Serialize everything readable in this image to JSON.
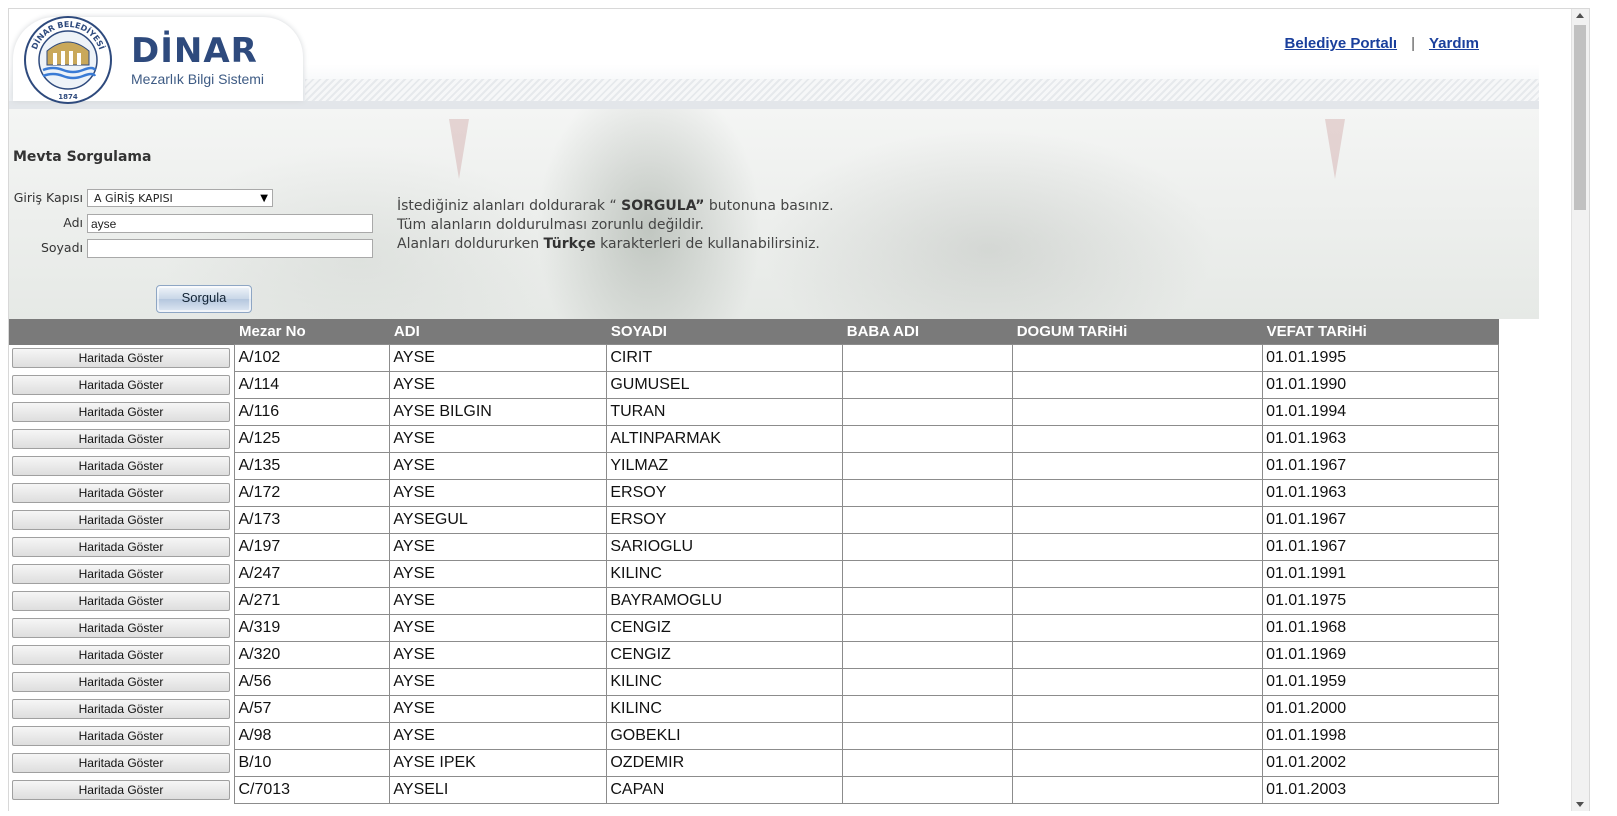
{
  "header": {
    "brand_name": "DİNAR",
    "brand_sub": "Mezarlık Bilgi Sistemi",
    "seal_text": "DİNAR BELEDİYESİ",
    "seal_year": "1874",
    "nav": {
      "portal": "Belediye Portalı",
      "separator": "|",
      "help": "Yardım"
    }
  },
  "search": {
    "title": "Mevta Sorgulama",
    "gate_label": "Giriş Kapısı",
    "gate_value": "A GİRİŞ KAPISI",
    "name_label": "Adı",
    "name_value": "ayse",
    "surname_label": "Soyadı",
    "surname_value": "",
    "button": "Sorgula",
    "instructions": {
      "line1_a": "İstediğiniz alanları doldurarak “ ",
      "line1_b": "SORGULA”",
      "line1_c": " butonuna basınız.",
      "line2": "Tüm alanların doldurulması zorunlu değildir.",
      "line3_a": "Alanları doldururken ",
      "line3_b": "Türkçe",
      "line3_c": " karakterleri de kullanabilirsiniz."
    }
  },
  "table": {
    "headers": [
      "",
      "Mezar No",
      "ADI",
      "SOYADI",
      "BABA ADI",
      "DOGUM TARiHi",
      "VEFAT TARiHi"
    ],
    "button_label": "Haritada Göster",
    "rows": [
      {
        "mezar": "A/102",
        "adi": "AYSE",
        "soyadi": "CIRIT",
        "baba": "",
        "dogum": "",
        "vefat": "01.01.1995"
      },
      {
        "mezar": "A/114",
        "adi": "AYSE",
        "soyadi": "GUMUSEL",
        "baba": "",
        "dogum": "",
        "vefat": "01.01.1990"
      },
      {
        "mezar": "A/116",
        "adi": "AYSE BILGIN",
        "soyadi": "TURAN",
        "baba": "",
        "dogum": "",
        "vefat": "01.01.1994"
      },
      {
        "mezar": "A/125",
        "adi": "AYSE",
        "soyadi": "ALTINPARMAK",
        "baba": "",
        "dogum": "",
        "vefat": "01.01.1963"
      },
      {
        "mezar": "A/135",
        "adi": "AYSE",
        "soyadi": "YILMAZ",
        "baba": "",
        "dogum": "",
        "vefat": "01.01.1967"
      },
      {
        "mezar": "A/172",
        "adi": "AYSE",
        "soyadi": "ERSOY",
        "baba": "",
        "dogum": "",
        "vefat": "01.01.1963"
      },
      {
        "mezar": "A/173",
        "adi": "AYSEGUL",
        "soyadi": "ERSOY",
        "baba": "",
        "dogum": "",
        "vefat": "01.01.1967"
      },
      {
        "mezar": "A/197",
        "adi": "AYSE",
        "soyadi": "SARIOGLU",
        "baba": "",
        "dogum": "",
        "vefat": "01.01.1967"
      },
      {
        "mezar": "A/247",
        "adi": "AYSE",
        "soyadi": "KILINC",
        "baba": "",
        "dogum": "",
        "vefat": "01.01.1991"
      },
      {
        "mezar": "A/271",
        "adi": "AYSE",
        "soyadi": "BAYRAMOGLU",
        "baba": "",
        "dogum": "",
        "vefat": "01.01.1975"
      },
      {
        "mezar": "A/319",
        "adi": "AYSE",
        "soyadi": "CENGIZ",
        "baba": "",
        "dogum": "",
        "vefat": "01.01.1968"
      },
      {
        "mezar": "A/320",
        "adi": "AYSE",
        "soyadi": "CENGIZ",
        "baba": "",
        "dogum": "",
        "vefat": "01.01.1969"
      },
      {
        "mezar": "A/56",
        "adi": "AYSE",
        "soyadi": "KILINC",
        "baba": "",
        "dogum": "",
        "vefat": "01.01.1959"
      },
      {
        "mezar": "A/57",
        "adi": "AYSE",
        "soyadi": "KILINC",
        "baba": "",
        "dogum": "",
        "vefat": "01.01.2000"
      },
      {
        "mezar": "A/98",
        "adi": "AYSE",
        "soyadi": "GOBEKLI",
        "baba": "",
        "dogum": "",
        "vefat": "01.01.1998"
      },
      {
        "mezar": "B/10",
        "adi": "AYSE IPEK",
        "soyadi": "OZDEMIR",
        "baba": "",
        "dogum": "",
        "vefat": "01.01.2002"
      },
      {
        "mezar": "C/7013",
        "adi": "AYSELI",
        "soyadi": "CAPAN",
        "baba": "",
        "dogum": "",
        "vefat": "01.01.2003"
      }
    ]
  },
  "colors": {
    "brand": "#2e4a7d",
    "link": "#1a3f9c",
    "table_header": "#7a7a7a"
  }
}
